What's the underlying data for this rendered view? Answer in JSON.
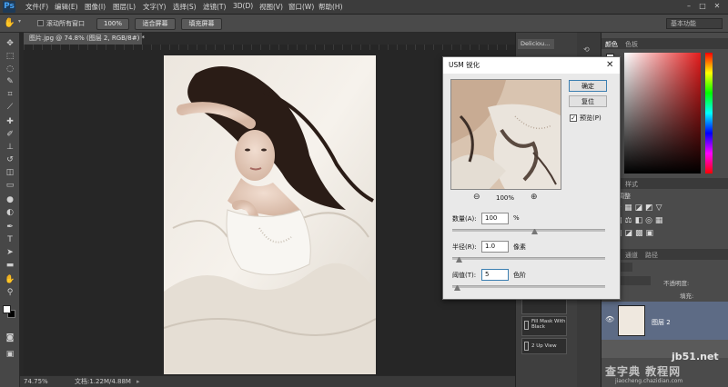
{
  "app": {
    "logo": "Ps"
  },
  "menu": [
    "文件(F)",
    "编辑(E)",
    "图像(I)",
    "图层(L)",
    "文字(Y)",
    "选择(S)",
    "滤镜(T)",
    "3D(D)",
    "视图(V)",
    "窗口(W)",
    "帮助(H)"
  ],
  "options": {
    "scroll_all_label": "滚动所有窗口",
    "zoom_label": "100%",
    "fit_label": "适合屏幕",
    "fill_label": "填充屏幕",
    "workspace": "基本功能"
  },
  "document": {
    "tab": "图片.jpg @ 74.8% (图层 2, RGB/8#) *"
  },
  "status": {
    "zoom": "74.75%",
    "doc": "文档:1.22M/4.88M"
  },
  "dialog": {
    "title": "USM 锐化",
    "ok": "确定",
    "reset": "复位",
    "preview": "预览(P)",
    "preview_zoom": "100%",
    "amount_label": "数量(A):",
    "amount_value": "100",
    "amount_unit": "%",
    "radius_label": "半径(R):",
    "radius_value": "1.0",
    "radius_unit": "像素",
    "threshold_label": "阈值(T):",
    "threshold_value": "5",
    "threshold_unit": "色阶"
  },
  "dock": {
    "tab": "Deliciou...",
    "items": [
      "Fill Mask With Black",
      "2 Up View"
    ]
  },
  "panels": {
    "color_tab": "颜色",
    "swatches_tab": "色板",
    "adjust_tab": "调整",
    "styles_tab": "样式",
    "add_adjust": "添加调整",
    "layers_tabs": [
      "图层",
      "通道",
      "路径"
    ],
    "kind": "类型",
    "blend": "正常",
    "opacity_label": "不透明度:",
    "fill_label": "填充:",
    "layer_name": "图层 2"
  },
  "watermark": {
    "site": "jb51.net",
    "text": "查字典 教程网",
    "url": "jiaocheng.chazidian.com"
  },
  "colors": {
    "fg": "#ffffff",
    "bg": "#000000"
  }
}
